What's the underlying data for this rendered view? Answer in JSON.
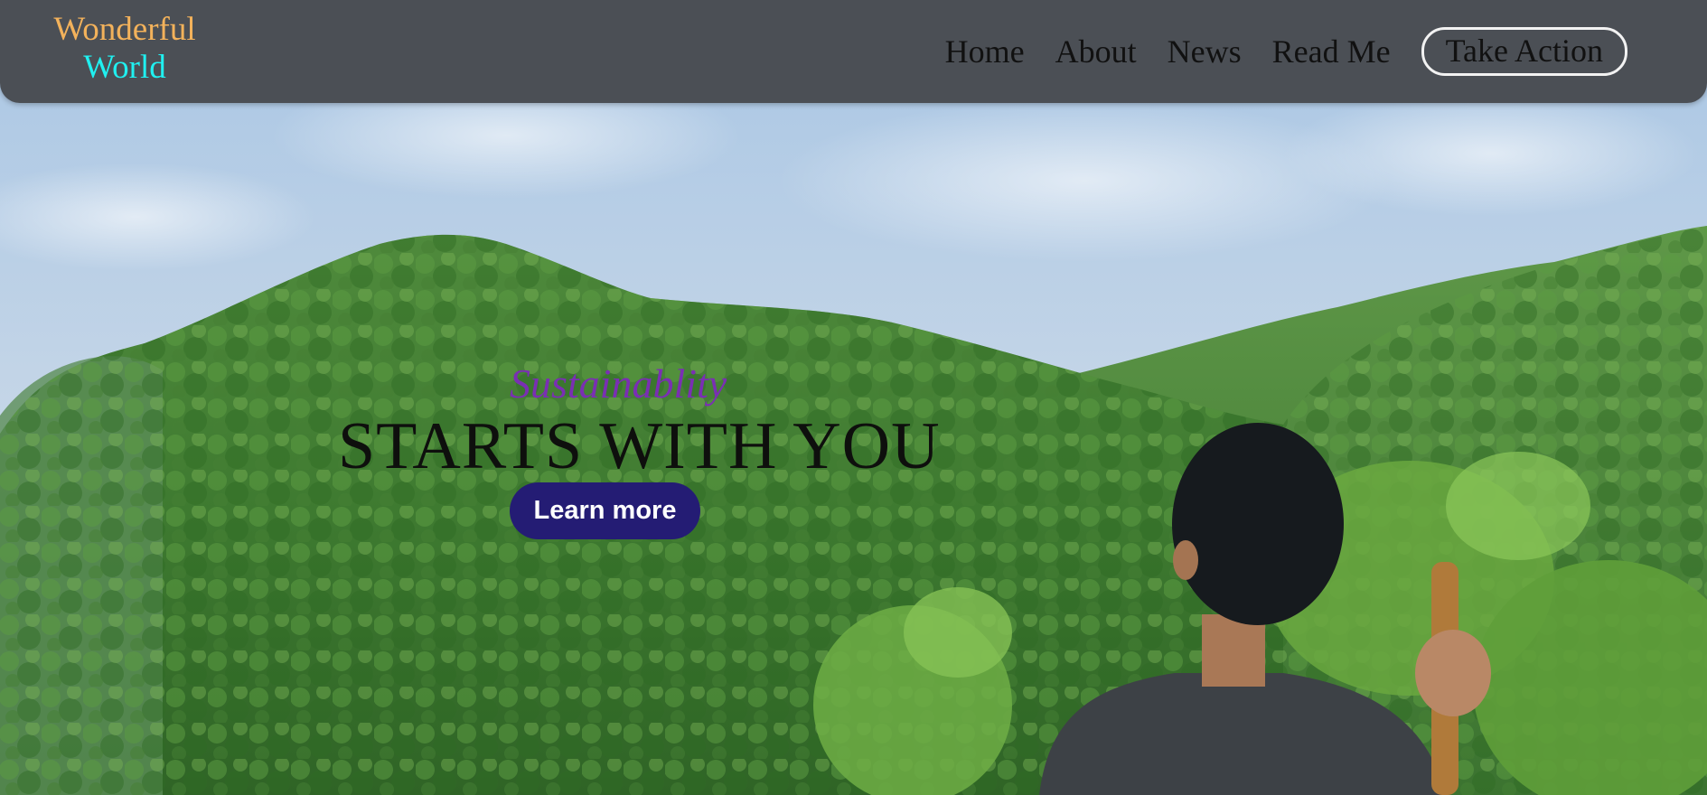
{
  "logo": {
    "line1": "Wonderful",
    "line2": "World"
  },
  "nav": {
    "items": [
      {
        "label": "Home"
      },
      {
        "label": "About"
      },
      {
        "label": "News"
      },
      {
        "label": "Read Me"
      }
    ],
    "cta_label": "Take Action"
  },
  "hero": {
    "kicker": "Sustainablity",
    "title": "STARTS WITH YOU",
    "button_label": "Learn more"
  },
  "colors": {
    "navbar_bg": "#4b4f55",
    "logo_line1": "#f3b25b",
    "logo_line2": "#20f0f0",
    "kicker": "#7a2fb3",
    "title": "#0e0f0d",
    "button_bg": "#241c74",
    "button_text": "#ffffff"
  }
}
